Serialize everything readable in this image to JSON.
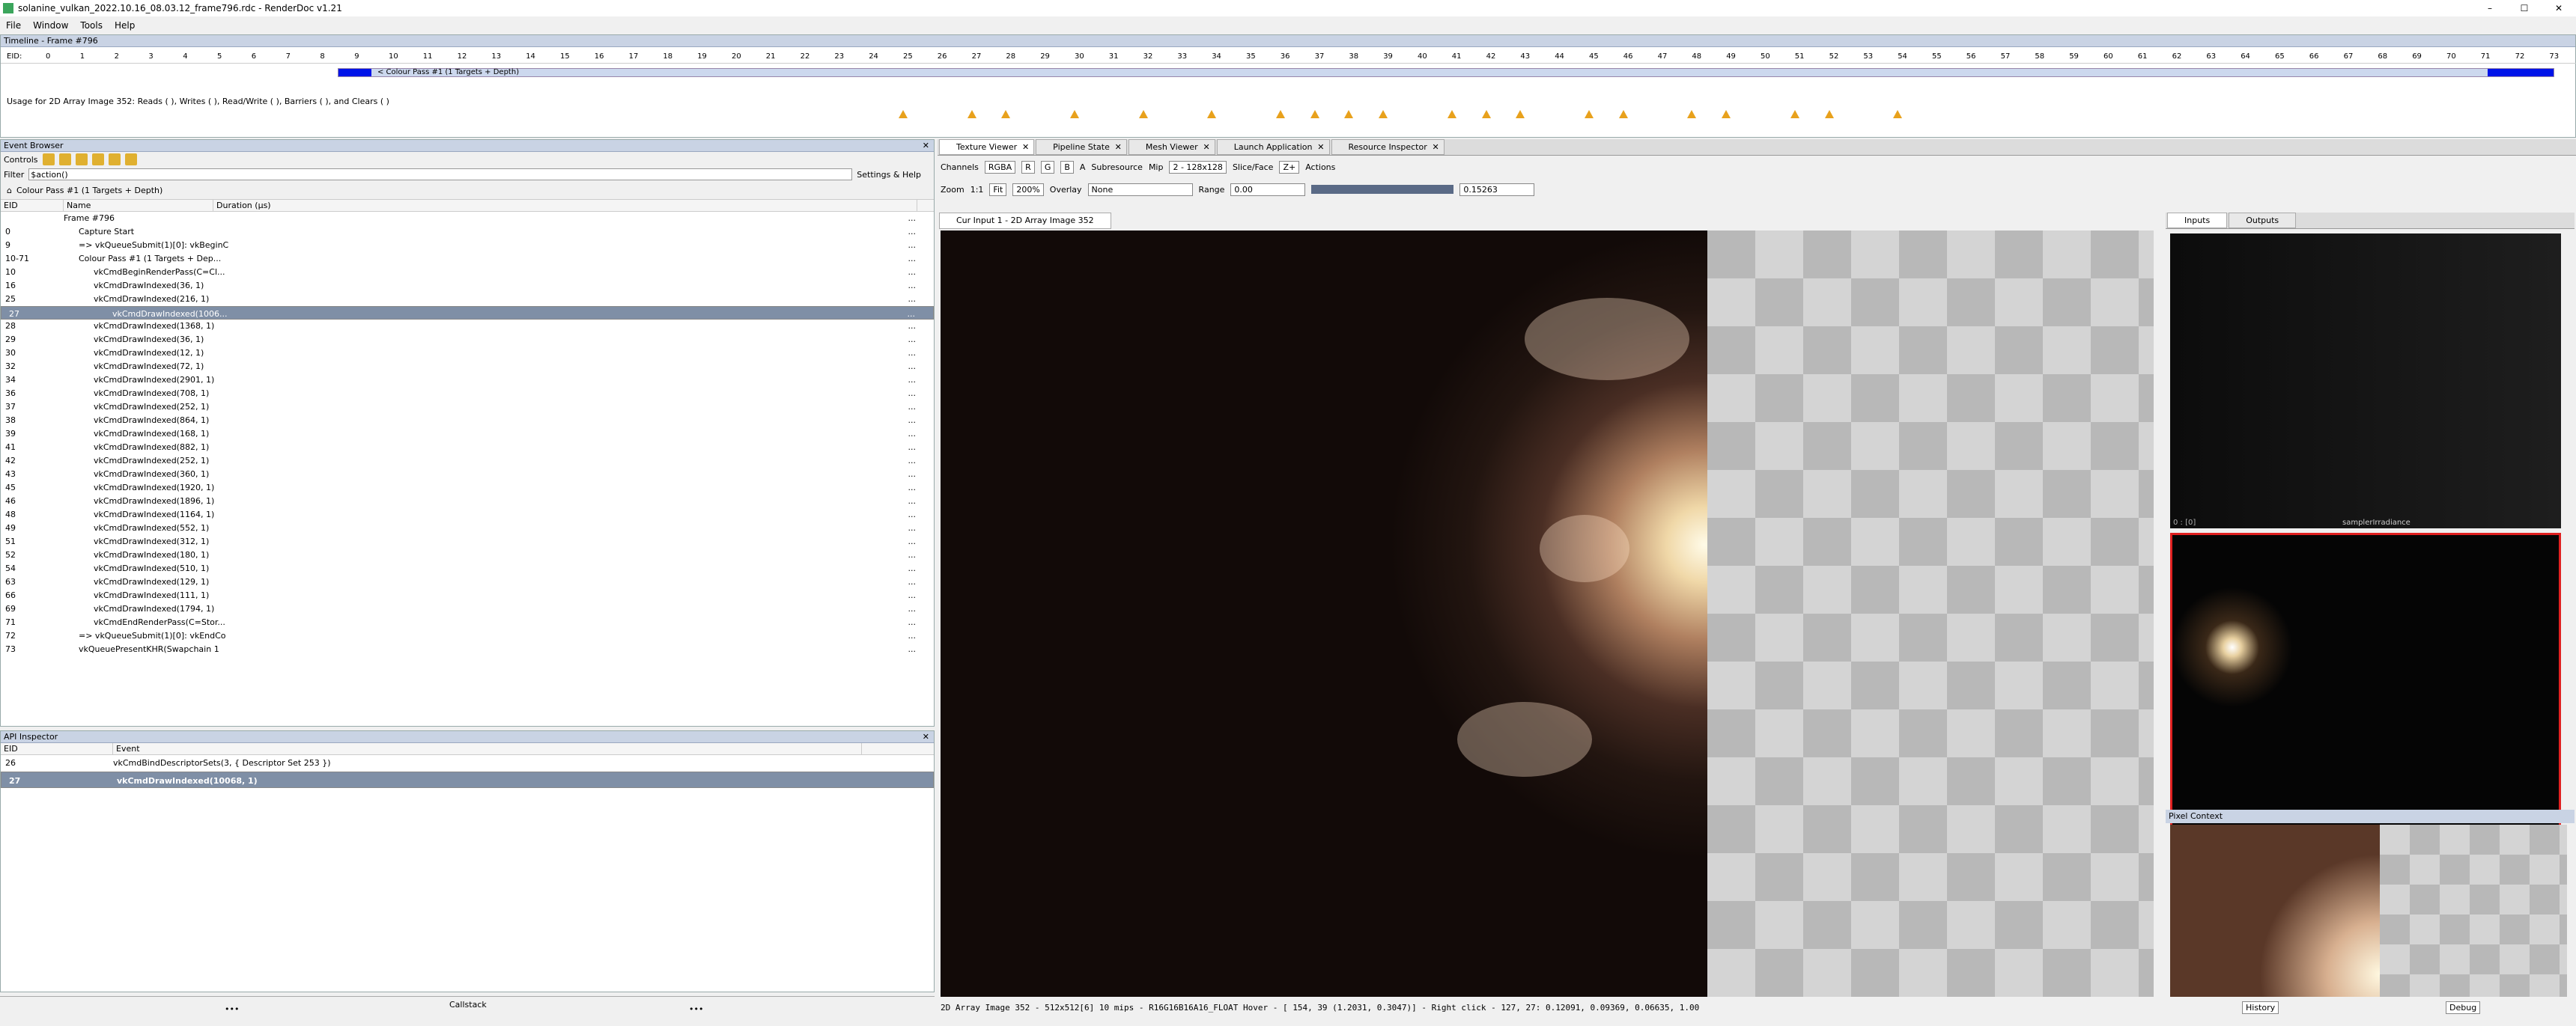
{
  "window": {
    "title": "solanine_vulkan_2022.10.16_08.03.12_frame796.rdc - RenderDoc v1.21",
    "min": "–",
    "max": "☐",
    "close": "✕"
  },
  "menu": [
    "File",
    "Window",
    "Tools",
    "Help"
  ],
  "timeline": {
    "panel_title": "Timeline - Frame #796",
    "eid_label": "EID:",
    "ticks": [
      "0",
      "1",
      "2",
      "3",
      "4",
      "5",
      "6",
      "7",
      "8",
      "9",
      "10",
      "11",
      "12",
      "13",
      "14",
      "15",
      "16",
      "17",
      "18",
      "19",
      "20",
      "21",
      "22",
      "23",
      "24",
      "25",
      "26",
      "27",
      "28",
      "29",
      "30",
      "31",
      "32",
      "33",
      "34",
      "35",
      "36",
      "37",
      "38",
      "39",
      "40",
      "41",
      "42",
      "43",
      "44",
      "45",
      "46",
      "47",
      "48",
      "49",
      "50",
      "51",
      "52",
      "53",
      "54",
      "55",
      "56",
      "57",
      "58",
      "59",
      "60",
      "61",
      "62",
      "63",
      "64",
      "65",
      "66",
      "67",
      "68",
      "69",
      "70",
      "71",
      "72",
      "73"
    ],
    "current_eid": "27",
    "pass_label": "< Colour Pass #1 (1 Targets + Depth)",
    "usage_text": "Usage for 2D Array Image 352: Reads ( ), Writes ( ), Read/Write ( ), Barriers ( ), and Clears ( )"
  },
  "event_browser": {
    "panel_title": "Event Browser",
    "controls_label": "Controls",
    "filter_label": "Filter",
    "filter_value": "$action()",
    "settings_label": "Settings & Help",
    "breadcrumb": "Colour Pass #1 (1 Targets + Depth)",
    "columns": [
      "EID",
      "Name",
      "Duration (µs)"
    ],
    "rows": [
      {
        "eid": "",
        "name": "Frame #796",
        "indent": 0
      },
      {
        "eid": "0",
        "name": "Capture Start",
        "indent": 1
      },
      {
        "eid": "9",
        "name": "=> vkQueueSubmit(1)[0]: vkBeginC",
        "indent": 1
      },
      {
        "eid": "10-71",
        "name": "Colour Pass #1 (1 Targets + Dep...",
        "indent": 1
      },
      {
        "eid": "10",
        "name": "vkCmdBeginRenderPass(C=Cl...",
        "indent": 2
      },
      {
        "eid": "16",
        "name": "vkCmdDrawIndexed(36, 1)",
        "indent": 2
      },
      {
        "eid": "25",
        "name": "vkCmdDrawIndexed(216, 1)",
        "indent": 2
      },
      {
        "eid": "27",
        "name": "vkCmdDrawIndexed(1006...",
        "indent": 3
      },
      {
        "eid": "28",
        "name": "vkCmdDrawIndexed(1368, 1)",
        "indent": 2
      },
      {
        "eid": "29",
        "name": "vkCmdDrawIndexed(36, 1)",
        "indent": 2
      },
      {
        "eid": "30",
        "name": "vkCmdDrawIndexed(12, 1)",
        "indent": 2
      },
      {
        "eid": "32",
        "name": "vkCmdDrawIndexed(72, 1)",
        "indent": 2
      },
      {
        "eid": "34",
        "name": "vkCmdDrawIndexed(2901, 1)",
        "indent": 2
      },
      {
        "eid": "36",
        "name": "vkCmdDrawIndexed(708, 1)",
        "indent": 2
      },
      {
        "eid": "37",
        "name": "vkCmdDrawIndexed(252, 1)",
        "indent": 2
      },
      {
        "eid": "38",
        "name": "vkCmdDrawIndexed(864, 1)",
        "indent": 2
      },
      {
        "eid": "39",
        "name": "vkCmdDrawIndexed(168, 1)",
        "indent": 2
      },
      {
        "eid": "41",
        "name": "vkCmdDrawIndexed(882, 1)",
        "indent": 2
      },
      {
        "eid": "42",
        "name": "vkCmdDrawIndexed(252, 1)",
        "indent": 2
      },
      {
        "eid": "43",
        "name": "vkCmdDrawIndexed(360, 1)",
        "indent": 2
      },
      {
        "eid": "45",
        "name": "vkCmdDrawIndexed(1920, 1)",
        "indent": 2
      },
      {
        "eid": "46",
        "name": "vkCmdDrawIndexed(1896, 1)",
        "indent": 2
      },
      {
        "eid": "48",
        "name": "vkCmdDrawIndexed(1164, 1)",
        "indent": 2
      },
      {
        "eid": "49",
        "name": "vkCmdDrawIndexed(552, 1)",
        "indent": 2
      },
      {
        "eid": "51",
        "name": "vkCmdDrawIndexed(312, 1)",
        "indent": 2
      },
      {
        "eid": "52",
        "name": "vkCmdDrawIndexed(180, 1)",
        "indent": 2
      },
      {
        "eid": "54",
        "name": "vkCmdDrawIndexed(510, 1)",
        "indent": 2
      },
      {
        "eid": "63",
        "name": "vkCmdDrawIndexed(129, 1)",
        "indent": 2
      },
      {
        "eid": "66",
        "name": "vkCmdDrawIndexed(111, 1)",
        "indent": 2
      },
      {
        "eid": "69",
        "name": "vkCmdDrawIndexed(1794, 1)",
        "indent": 2
      },
      {
        "eid": "71",
        "name": "vkCmdEndRenderPass(C=Stor...",
        "indent": 2
      },
      {
        "eid": "72",
        "name": "=> vkQueueSubmit(1)[0]: vkEndCo",
        "indent": 1
      },
      {
        "eid": "73",
        "name": "vkQueuePresentKHR(Swapchain 1",
        "indent": 1
      }
    ],
    "selected_eid": "27",
    "row_dots": "...",
    "callstack_label": "Callstack",
    "more_left": "•••",
    "more_right": "•••"
  },
  "api_inspector": {
    "panel_title": "API Inspector",
    "columns": [
      "EID",
      "Event"
    ],
    "rows": [
      {
        "eid": "26",
        "event": "vkCmdBindDescriptorSets(3, { Descriptor Set 253 })"
      },
      {
        "eid": "27",
        "event": "vkCmdDrawIndexed(10068, 1)"
      }
    ]
  },
  "tabs": [
    "Texture Viewer",
    "Pipeline State",
    "Mesh Viewer",
    "Launch Application",
    "Resource Inspector"
  ],
  "texture_viewer": {
    "channels_label": "Channels",
    "channels_value": "RGBA",
    "channel_buttons": [
      "R",
      "G",
      "B",
      "A"
    ],
    "subresource_label": "Subresource",
    "mip_label": "Mip",
    "mip_value": "2 - 128x128",
    "slice_label": "Slice/Face",
    "slice_value": "Z+",
    "actions_label": "Actions",
    "zoom_label": "Zoom",
    "zoom_1to1": "1:1",
    "fit_label": "Fit",
    "zoom_value": "200%",
    "overlay_label": "Overlay",
    "overlay_value": "None",
    "range_label": "Range",
    "range_min": "0.00",
    "range_max": "0.15263",
    "image_tab": "Cur Input 1 - 2D Array Image 352",
    "status": "2D Array Image 352 - 512x512[6] 10 mips - R16G16B16A16_FLOAT  Hover - [ 154,   39 (1.2031, 0.3047)] - Right click -  127,   27: 0.12091, 0.09369, 0.06635, 1.00",
    "inputs_tab": "Inputs",
    "outputs_tab": "Outputs",
    "thumb1_label": "samplerIrradiance",
    "thumb1_index": "0 : [0]",
    "pixel_context_title": "Pixel Context",
    "history_button": "History",
    "debug_button": "Debug"
  }
}
